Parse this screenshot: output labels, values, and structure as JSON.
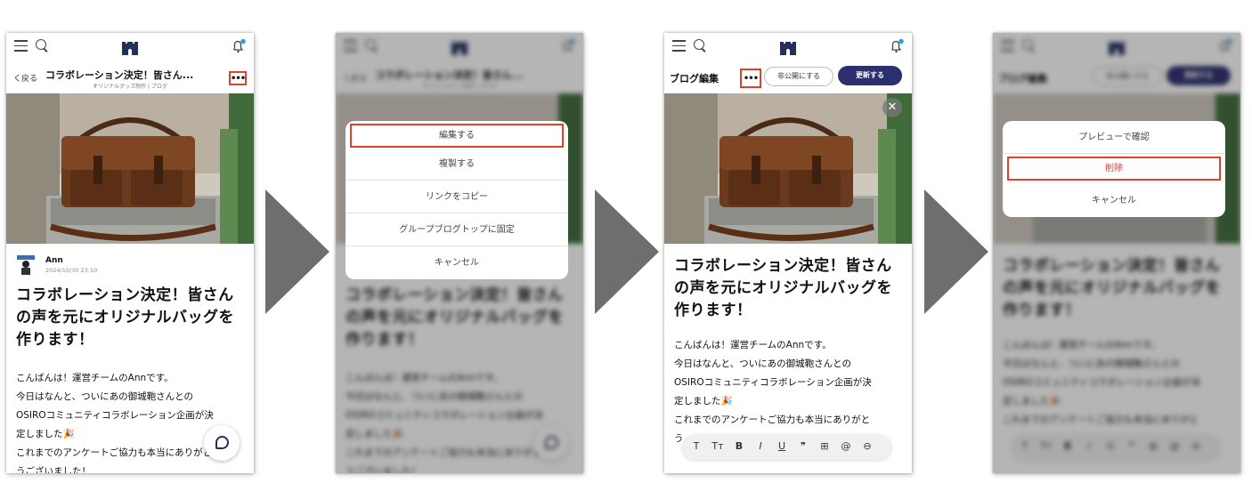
{
  "header": {
    "back_label": "く戻る",
    "post_title_short": "コラボレーション決定！皆さん...",
    "post_subtitle": "オリジナルグッズ制作 | ブログ",
    "more_label": "•••"
  },
  "post": {
    "author_name": "Ann",
    "date": "2024/10/30 23:10",
    "title": "コラボレーション決定！皆さんの声を元にオリジナルバッグを作ります！",
    "body_lines": [
      "こんばんは！運営チームのAnnです。",
      "今日はなんと、ついにあの御城鞄さんとの",
      "OSIROコミュニティコラボレーション企画が決",
      "定しました🎉",
      "これまでのアンケートご協力も本当にありがと",
      "うございました！"
    ]
  },
  "menu1": {
    "items": [
      "編集する",
      "複製する",
      "リンクをコピー",
      "グループブログトップに固定",
      "キャンセル"
    ]
  },
  "editor": {
    "title": "ブログ編集",
    "more_label": "•••",
    "hide_label": "非公開にする",
    "update_label": "更新する",
    "close_label": "✕",
    "body_lines": [
      "こんばんは！運営チームのAnnです。",
      "今日はなんと、ついにあの御城鞄さんとの",
      "OSIROコミュニティコラボレーション企画が決",
      "定しました🎉",
      "これまでのアンケートご協力も本当にありがと",
      "う"
    ],
    "toolbar": [
      "T",
      "Tт",
      "B",
      "I",
      "U",
      "❞",
      "⊞",
      "@",
      "⊖"
    ]
  },
  "menu2": {
    "items": [
      "プレビューで確認",
      "削除",
      "キャンセル"
    ]
  },
  "colors": {
    "accent": "#e0402e",
    "brand": "#2b2f6e",
    "arrow": "#6e6e6e"
  }
}
